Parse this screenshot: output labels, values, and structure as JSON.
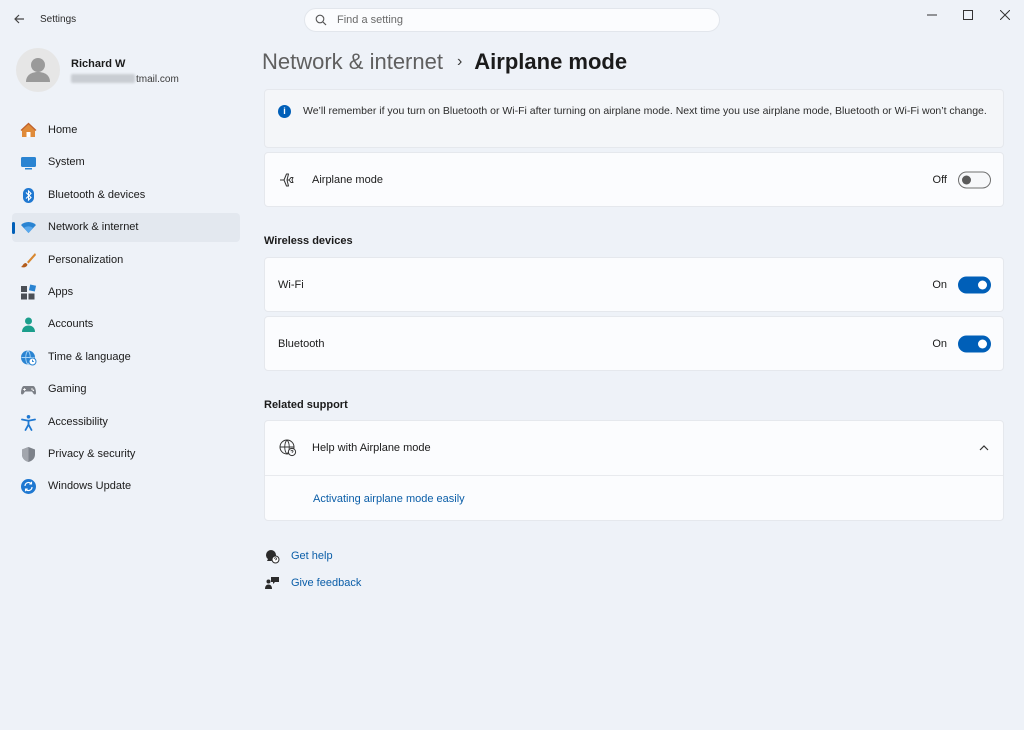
{
  "app": {
    "title": "Settings"
  },
  "search": {
    "placeholder": "Find a setting"
  },
  "profile": {
    "name": "Richard W",
    "email_visible": "tmail.com"
  },
  "sidebar": {
    "items": [
      {
        "label": "Home",
        "icon": "home-icon"
      },
      {
        "label": "System",
        "icon": "system-icon"
      },
      {
        "label": "Bluetooth & devices",
        "icon": "bluetooth-icon"
      },
      {
        "label": "Network & internet",
        "icon": "wifi-icon",
        "active": true
      },
      {
        "label": "Personalization",
        "icon": "brush-icon"
      },
      {
        "label": "Apps",
        "icon": "apps-icon"
      },
      {
        "label": "Accounts",
        "icon": "accounts-icon"
      },
      {
        "label": "Time & language",
        "icon": "globe-clock-icon"
      },
      {
        "label": "Gaming",
        "icon": "gamepad-icon"
      },
      {
        "label": "Accessibility",
        "icon": "accessibility-icon"
      },
      {
        "label": "Privacy & security",
        "icon": "shield-icon"
      },
      {
        "label": "Windows Update",
        "icon": "update-icon"
      }
    ]
  },
  "header": {
    "parent": "Network & internet",
    "separator": "›",
    "current": "Airplane mode"
  },
  "info": {
    "text": "We’ll remember if you turn on Bluetooth or Wi-Fi after turning on airplane mode. Next time you use airplane mode, Bluetooth or Wi-Fi won’t change."
  },
  "airplane": {
    "label": "Airplane mode",
    "state": "Off",
    "on": false
  },
  "wireless": {
    "title": "Wireless devices",
    "wifi": {
      "label": "Wi-Fi",
      "state": "On",
      "on": true
    },
    "bluetooth": {
      "label": "Bluetooth",
      "state": "On",
      "on": true
    }
  },
  "support": {
    "title": "Related support",
    "help_title": "Help with Airplane mode",
    "link": "Activating airplane mode easily"
  },
  "footer": {
    "get_help": "Get help",
    "give_feedback": "Give feedback"
  },
  "colors": {
    "accent": "#005fb8",
    "background": "#eef2f8",
    "card": "#fbfcfe",
    "link": "#0b5ea8"
  }
}
